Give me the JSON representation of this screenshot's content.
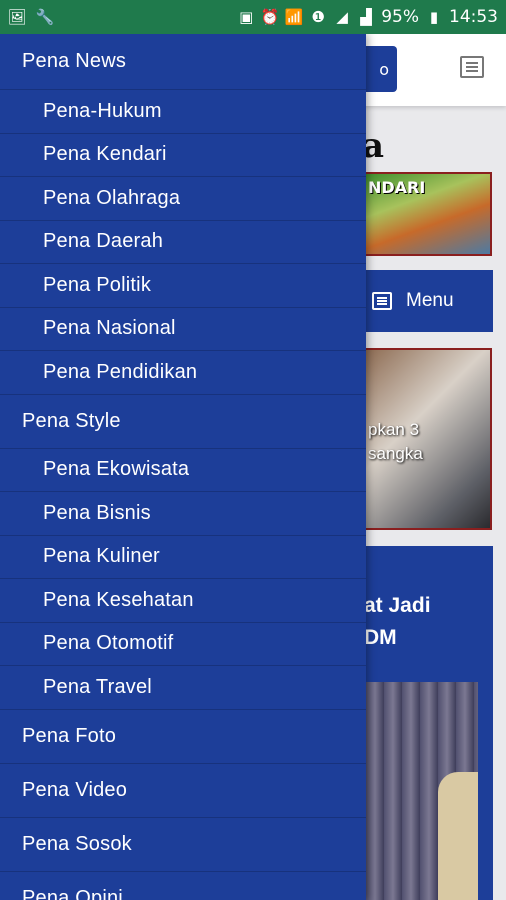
{
  "status_bar": {
    "battery": "95%",
    "time": "14:53",
    "left_icons": [
      "image-icon",
      "wrench-icon"
    ],
    "right_icons": [
      "sim-icon",
      "alarm-icon",
      "wifi-icon",
      "sim1-icon",
      "signal-icon",
      "signal2-icon",
      "battery-icon"
    ]
  },
  "drawer": {
    "items": [
      {
        "label": "Pena News",
        "level": "top"
      },
      {
        "label": "Pena-Hukum",
        "level": "sub"
      },
      {
        "label": "Pena Kendari",
        "level": "sub"
      },
      {
        "label": "Pena Olahraga",
        "level": "sub"
      },
      {
        "label": "Pena Daerah",
        "level": "sub"
      },
      {
        "label": "Pena Politik",
        "level": "sub"
      },
      {
        "label": "Pena Nasional",
        "level": "sub"
      },
      {
        "label": "Pena Pendidikan",
        "level": "sub"
      },
      {
        "label": "Pena Style",
        "level": "top"
      },
      {
        "label": "Pena Ekowisata",
        "level": "sub"
      },
      {
        "label": "Pena Bisnis",
        "level": "sub"
      },
      {
        "label": "Pena Kuliner",
        "level": "sub"
      },
      {
        "label": "Pena Kesehatan",
        "level": "sub"
      },
      {
        "label": "Pena Otomotif",
        "level": "sub"
      },
      {
        "label": "Pena Travel",
        "level": "sub"
      },
      {
        "label": "Pena Foto",
        "level": "top"
      },
      {
        "label": "Pena Video",
        "level": "top"
      },
      {
        "label": "Pena Sosok",
        "level": "top"
      },
      {
        "label": "Pena Opini",
        "level": "top"
      }
    ]
  },
  "background": {
    "header_pill_glyph": "o",
    "logo_glyph": "a",
    "banner_text": "NDARI",
    "nav_label": "Menu",
    "headline_1": "pkan 3\nsangka",
    "headline_2": "at Jadi\nDM"
  },
  "colors": {
    "status_bar": "#1f7a4c",
    "drawer_bg": "#1d3e99",
    "text": "#ffffff"
  }
}
